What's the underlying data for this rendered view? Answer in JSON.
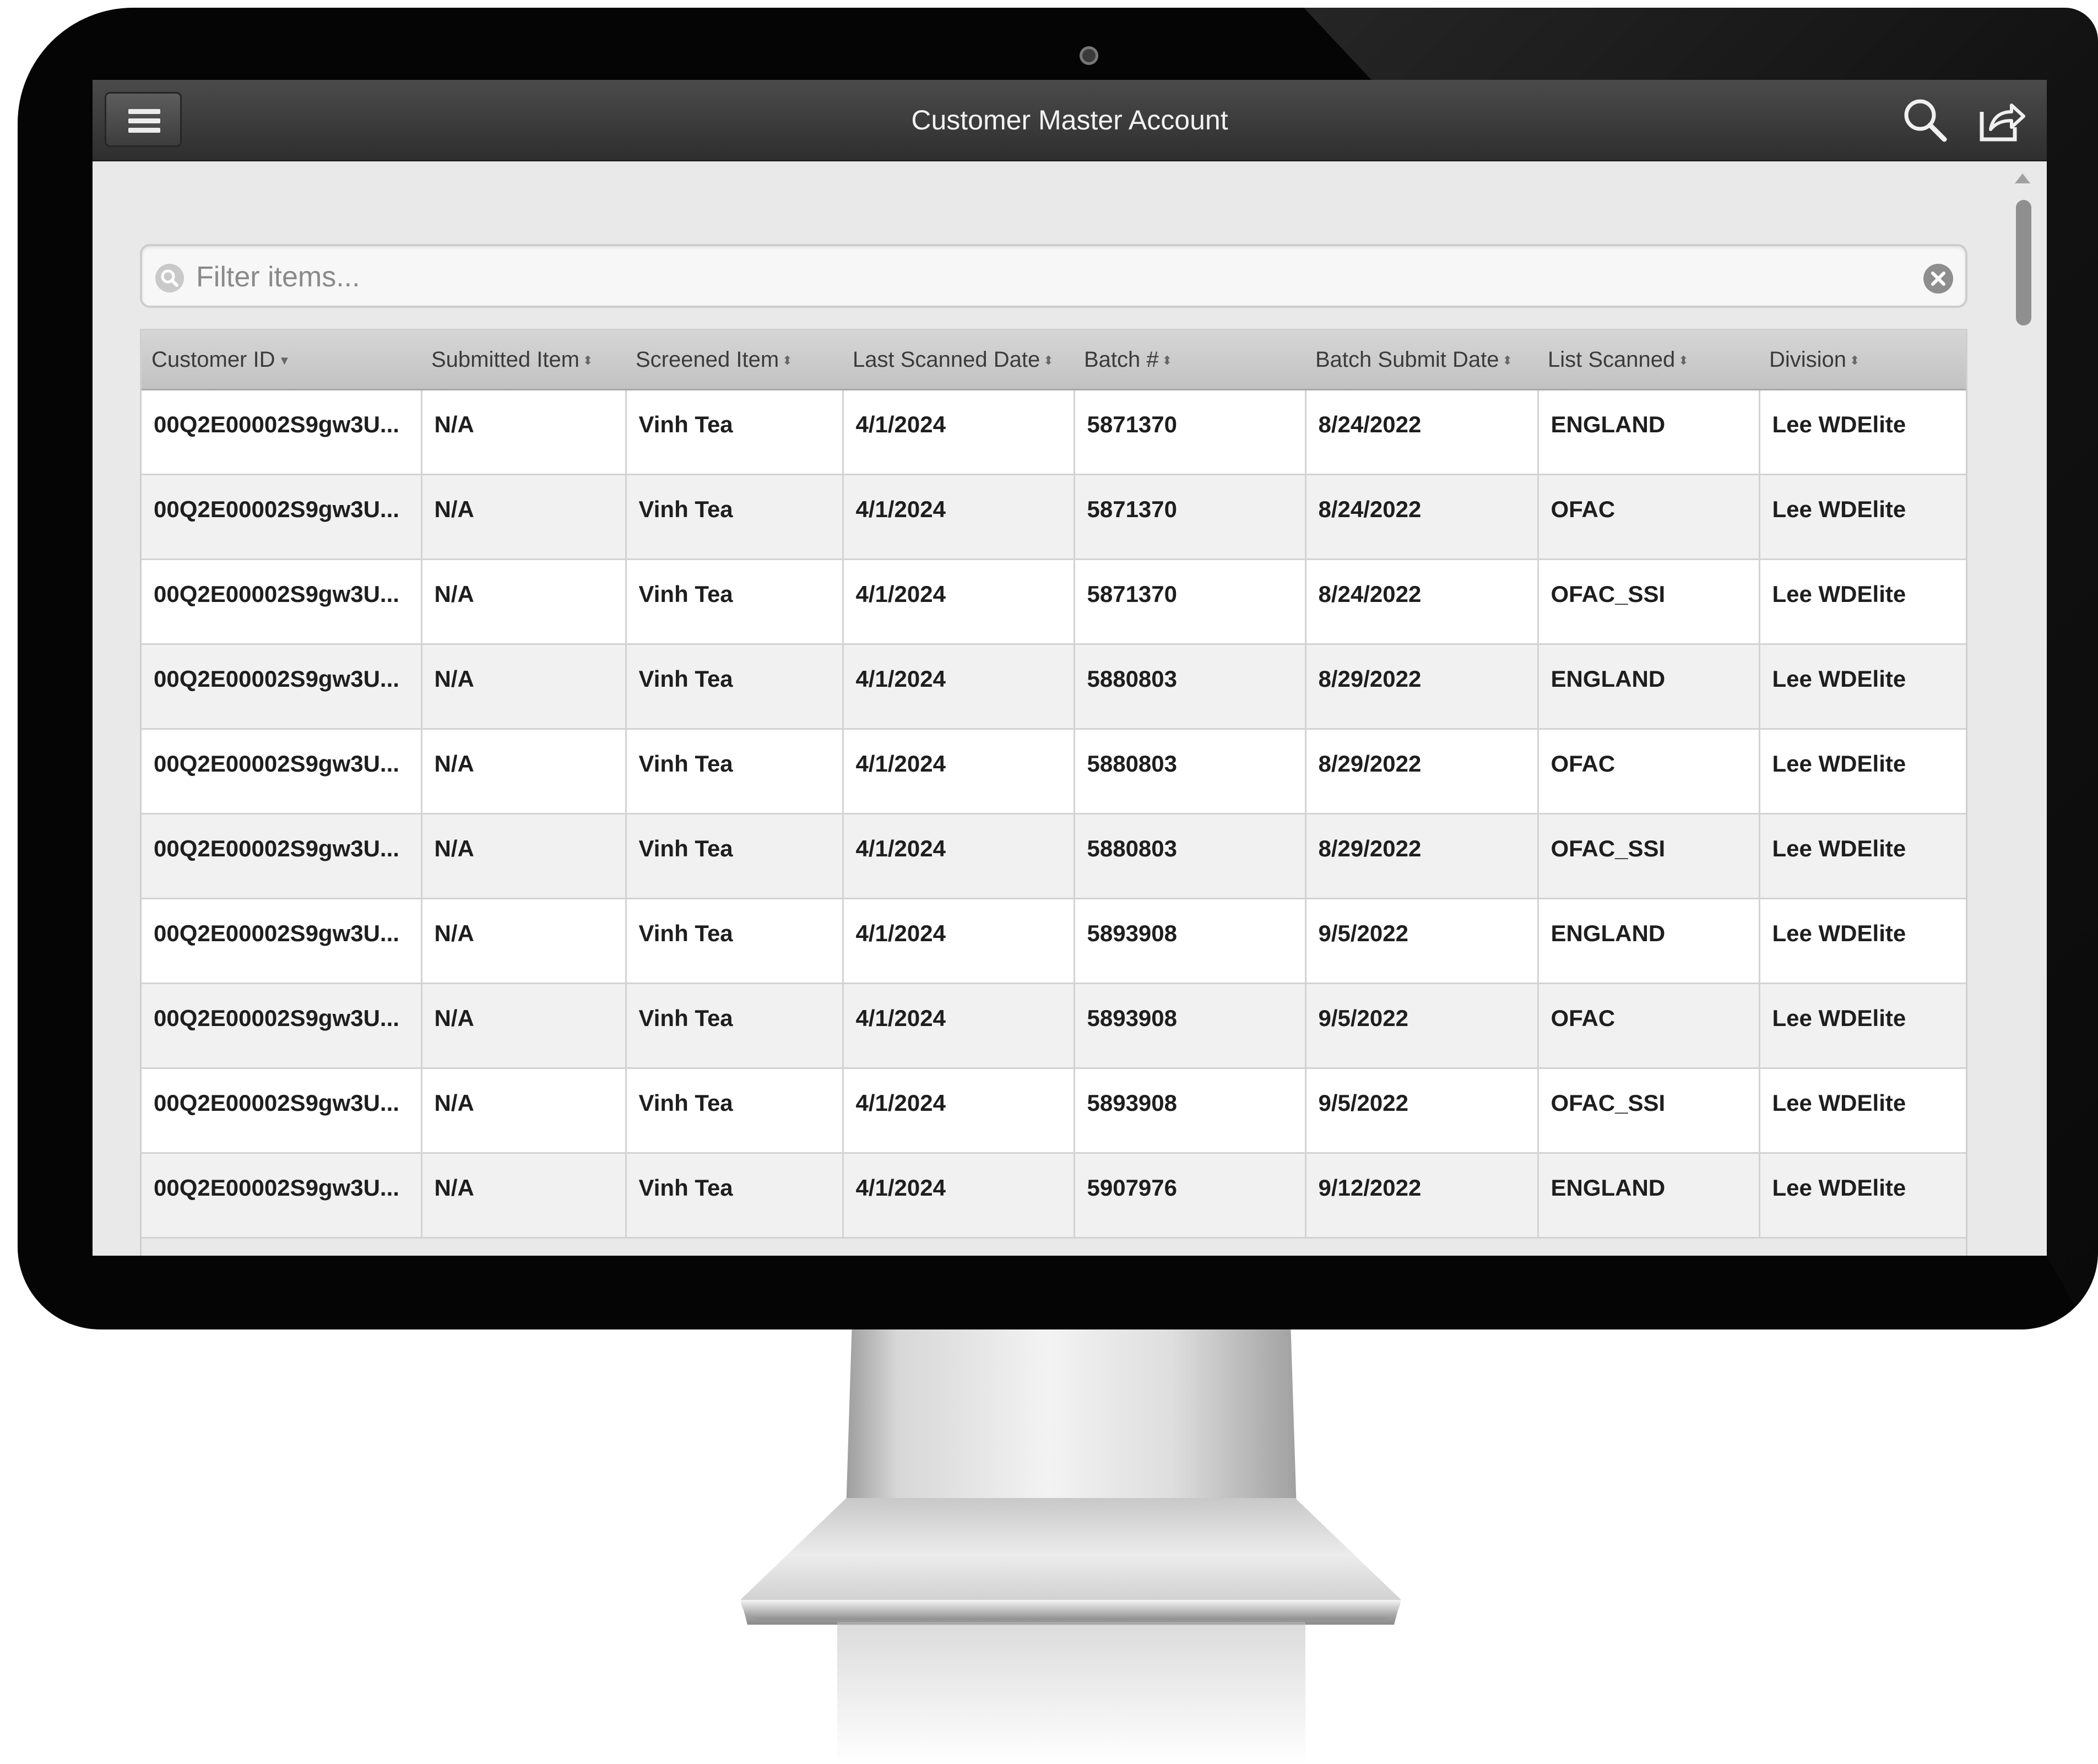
{
  "app": {
    "title": "Customer Master Account"
  },
  "toolbar": {
    "menu_icon": "hamburger-icon",
    "search_icon": "search-icon",
    "share_icon": "share-icon"
  },
  "filter": {
    "placeholder": "Filter items..."
  },
  "table": {
    "columns": [
      {
        "label": "Customer ID",
        "sort": "descending"
      },
      {
        "label": "Submitted Item",
        "sort": "none"
      },
      {
        "label": "Screened Item",
        "sort": "none"
      },
      {
        "label": "Last Scanned Date",
        "sort": "none"
      },
      {
        "label": "Batch #",
        "sort": "none"
      },
      {
        "label": "Batch Submit Date",
        "sort": "none"
      },
      {
        "label": "List Scanned",
        "sort": "none"
      },
      {
        "label": "Division",
        "sort": "none"
      }
    ],
    "rows": [
      [
        "00Q2E00002S9gw3U...",
        "N/A",
        "Vinh Tea",
        "4/1/2024",
        "5871370",
        "8/24/2022",
        "ENGLAND",
        "Lee WDElite"
      ],
      [
        "00Q2E00002S9gw3U...",
        "N/A",
        "Vinh Tea",
        "4/1/2024",
        "5871370",
        "8/24/2022",
        "OFAC",
        "Lee WDElite"
      ],
      [
        "00Q2E00002S9gw3U...",
        "N/A",
        "Vinh Tea",
        "4/1/2024",
        "5871370",
        "8/24/2022",
        "OFAC_SSI",
        "Lee WDElite"
      ],
      [
        "00Q2E00002S9gw3U...",
        "N/A",
        "Vinh Tea",
        "4/1/2024",
        "5880803",
        "8/29/2022",
        "ENGLAND",
        "Lee WDElite"
      ],
      [
        "00Q2E00002S9gw3U...",
        "N/A",
        "Vinh Tea",
        "4/1/2024",
        "5880803",
        "8/29/2022",
        "OFAC",
        "Lee WDElite"
      ],
      [
        "00Q2E00002S9gw3U...",
        "N/A",
        "Vinh Tea",
        "4/1/2024",
        "5880803",
        "8/29/2022",
        "OFAC_SSI",
        "Lee WDElite"
      ],
      [
        "00Q2E00002S9gw3U...",
        "N/A",
        "Vinh Tea",
        "4/1/2024",
        "5893908",
        "9/5/2022",
        "ENGLAND",
        "Lee WDElite"
      ],
      [
        "00Q2E00002S9gw3U...",
        "N/A",
        "Vinh Tea",
        "4/1/2024",
        "5893908",
        "9/5/2022",
        "OFAC",
        "Lee WDElite"
      ],
      [
        "00Q2E00002S9gw3U...",
        "N/A",
        "Vinh Tea",
        "4/1/2024",
        "5893908",
        "9/5/2022",
        "OFAC_SSI",
        "Lee WDElite"
      ],
      [
        "00Q2E00002S9gw3U...",
        "N/A",
        "Vinh Tea",
        "4/1/2024",
        "5907976",
        "9/12/2022",
        "ENGLAND",
        "Lee WDElite"
      ]
    ]
  },
  "colors": {
    "topbar": "#333333",
    "header_row": "#c9c9c9",
    "row_alt": "#f1f1f1",
    "background": "#e9e9e9"
  }
}
